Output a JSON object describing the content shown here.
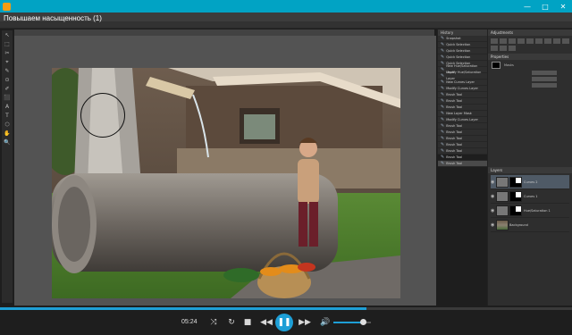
{
  "window": {
    "title": "Повышаем насыщенность (1)",
    "controls": {
      "minimize": "—",
      "maximize": "□",
      "close": "✕"
    }
  },
  "photoshop": {
    "tools": [
      "↖",
      "⬚",
      "✂",
      "⌖",
      "✎",
      "⊙",
      "✐",
      "⬛",
      "A",
      "T",
      "⬡",
      "✋",
      "🔍"
    ],
    "history": {
      "title": "History",
      "items": [
        "Snapshot",
        "Quick Selection",
        "Quick Selection",
        "Quick Selection",
        "Quick Selection",
        "New Hue/Saturation Layer",
        "Modify Hue/Saturation Layer",
        "New Curves Layer",
        "Modify Curves Layer",
        "Brush Tool",
        "Brush Tool",
        "Brush Tool",
        "New Layer Mask",
        "Modify Curves Layer",
        "Brush Tool",
        "Brush Tool",
        "Brush Tool",
        "Brush Tool",
        "Brush Tool",
        "Brush Tool",
        "Brush Tool"
      ]
    },
    "adjustments": {
      "title": "Adjustments"
    },
    "properties": {
      "title": "Properties",
      "mask_label": "Masks"
    },
    "layers": {
      "title": "Layers",
      "items": [
        {
          "name": "Curves 2",
          "active": true,
          "mask": "black"
        },
        {
          "name": "Curves 1",
          "active": false,
          "mask": "black"
        },
        {
          "name": "Hue/Saturation 1",
          "active": false,
          "mask": "black"
        },
        {
          "name": "Background",
          "active": false,
          "mask": "none"
        }
      ]
    }
  },
  "player": {
    "time": "05:24",
    "progress": 0.64,
    "volume": 0.82,
    "icons": {
      "shuffle": "⤨",
      "loop": "↻",
      "stop": "■",
      "prev": "◀◀",
      "play": "❚❚",
      "next": "▶▶",
      "playlist": "≡",
      "volume": "🔊"
    }
  },
  "colors": {
    "titlebar": "#01a3c4",
    "accent": "#1e9fd6",
    "panel": "#2e2e2e",
    "canvas": "#535353"
  }
}
